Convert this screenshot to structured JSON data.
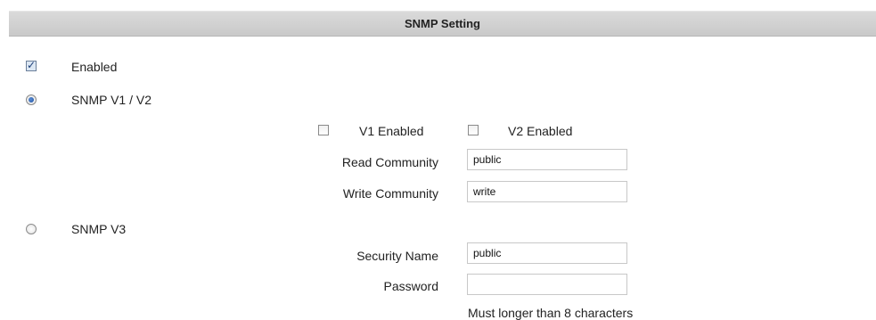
{
  "section": {
    "title": "SNMP Setting"
  },
  "enabled": {
    "label": "Enabled",
    "checked": true
  },
  "snmp_v1v2": {
    "label": "SNMP V1 / V2",
    "selected": true,
    "v1_enabled": {
      "label": "V1 Enabled",
      "checked": false
    },
    "v2_enabled": {
      "label": "V2 Enabled",
      "checked": false
    },
    "read_community": {
      "label": "Read Community",
      "value": "public"
    },
    "write_community": {
      "label": "Write Community",
      "value": "write"
    }
  },
  "snmp_v3": {
    "label": "SNMP V3",
    "selected": false,
    "security_name": {
      "label": "Security Name",
      "value": "public"
    },
    "password": {
      "label": "Password",
      "value": "",
      "hint": "Must longer than 8 characters"
    }
  }
}
